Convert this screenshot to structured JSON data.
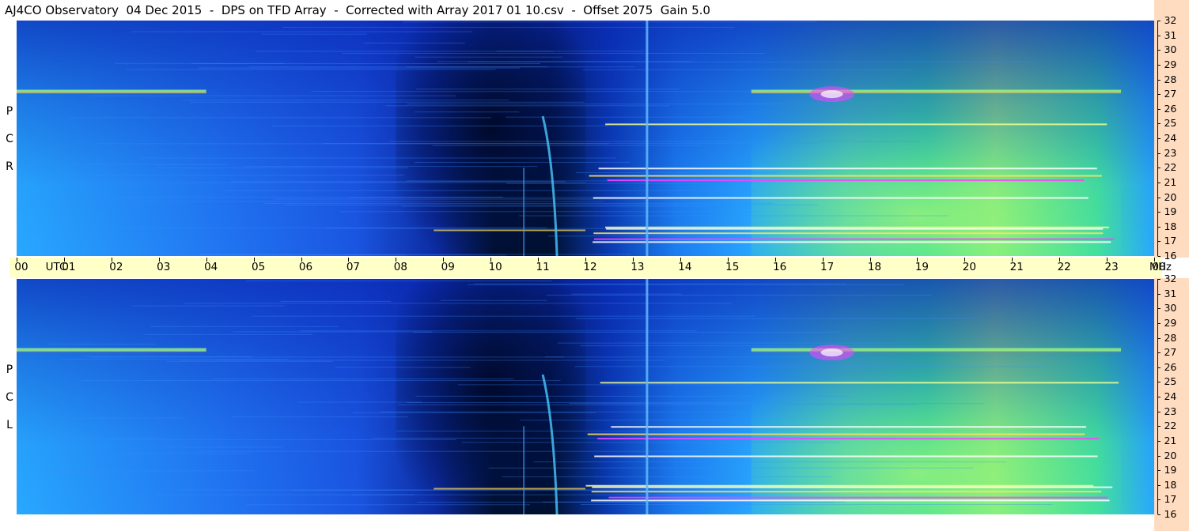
{
  "title": "AJ4CO Observatory  04 Dec 2015  -  DPS on TFD Array  -  Corrected with Array 2017 01 10.csv  -  Offset 2075  Gain 5.0",
  "panels": [
    {
      "id": "rcp",
      "label_letters": [
        "P",
        "C",
        "R"
      ]
    },
    {
      "id": "lcp",
      "label_letters": [
        "P",
        "C",
        "L"
      ]
    }
  ],
  "colors": {
    "background_blue": "#1a55e0",
    "deep_blue": "#001030",
    "light_blue": "#28a8ff",
    "cyan_green": "#40e0a0",
    "yellow_green": "#c8ff60",
    "magenta": "#ff40ff",
    "time_band": "#ffffc8",
    "freq_axis": "#ffdcc0"
  },
  "chart_data": {
    "type": "heatmap",
    "title": "AJ4CO Observatory  04 Dec 2015  -  DPS on TFD Array  -  Corrected with Array 2017 01 10.csv  -  Offset 2075  Gain 5.0",
    "x_axis": {
      "unit": "UTC",
      "ticks": [
        "00",
        "01",
        "02",
        "03",
        "04",
        "05",
        "06",
        "07",
        "08",
        "09",
        "10",
        "11",
        "12",
        "13",
        "14",
        "15",
        "16",
        "17",
        "18",
        "19",
        "20",
        "21",
        "22",
        "23",
        "00"
      ],
      "range": [
        0,
        24
      ]
    },
    "y_axis": {
      "unit": "MHz",
      "ticks": [
        "32",
        "31",
        "30",
        "29",
        "28",
        "27",
        "26",
        "25",
        "24",
        "23",
        "22",
        "21",
        "20",
        "19",
        "18",
        "17",
        "16"
      ],
      "range": [
        16,
        32
      ]
    },
    "series": [
      {
        "name": "RCP",
        "dark_region_utc": [
          8,
          12
        ],
        "bright_region_utc": [
          15.5,
          23.3
        ]
      },
      {
        "name": "LCP",
        "dark_region_utc": [
          8,
          12
        ],
        "bright_region_utc": [
          15.5,
          23.3
        ]
      }
    ],
    "features": {
      "band_27mhz_utc": [
        [
          0,
          4
        ],
        [
          15.5,
          23.3
        ]
      ],
      "vertical_line_utc": 13.3,
      "burst_utc": [
        10.6,
        11.4
      ]
    }
  }
}
